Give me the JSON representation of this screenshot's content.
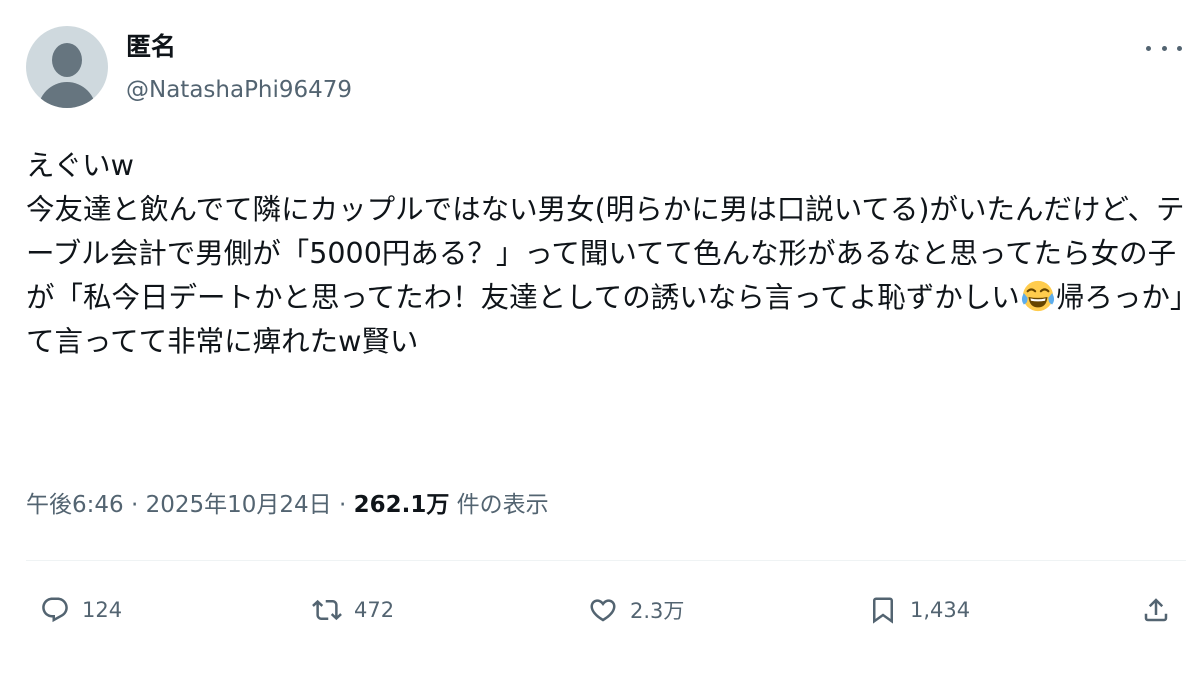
{
  "user": {
    "name": "匿名",
    "handle": "@NatashaPhi96479"
  },
  "tweet": {
    "text_before_emoji": "えぐいw\n今友達と飲んでて隣にカップルではない男女(明らかに男は口説いてる)がいたんだけど、テーブル会計で男側が「5000円ある？」って聞いてて色んな形があるなと思ってたら女の子が「私今日デートかと思ってたわ！友達としての誘いなら言ってよ恥ずかしい",
    "emoji": "face-with-tears-of-joy",
    "text_after_emoji": "帰ろっか」て言ってて非常に痺れたw賢い"
  },
  "meta": {
    "time": "午後6:46",
    "separator": " · ",
    "date": "2025年10月24日",
    "views_count": "262.1万",
    "views_label": " 件の表示"
  },
  "actions": {
    "reply_count": "124",
    "retweet_count": "472",
    "like_count": "2.3万",
    "bookmark_count": "1,434"
  },
  "colors": {
    "text": "#0f1419",
    "secondary": "#536471",
    "divider": "#eff3f4",
    "avatar_bg": "#cfd9de"
  }
}
